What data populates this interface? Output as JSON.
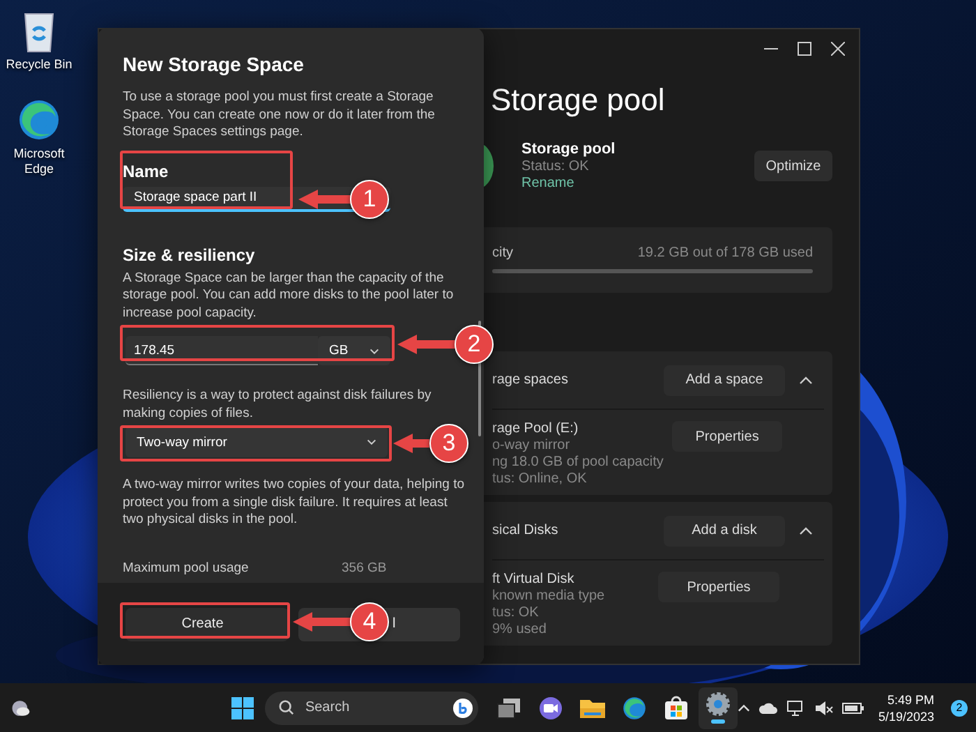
{
  "desktop_icons": [
    {
      "label": "Recycle Bin",
      "kind": "recycle"
    },
    {
      "label": "Microsoft Edge",
      "kind": "edge"
    }
  ],
  "background_window": {
    "title": "Storage pool",
    "pool": {
      "name": "Storage pool",
      "status": "Status: OK",
      "link": "Rename",
      "button": "Optimize"
    },
    "capacity": {
      "label": "city",
      "usage": "19.2 GB out of 178 GB used"
    },
    "sections": [
      {
        "title": "rage spaces",
        "button": "Add a space",
        "expanded": true,
        "items": [
          {
            "lines": [
              "rage Pool (E:)",
              "o-way mirror",
              "ng 18.0 GB of pool capacity",
              "tus: Online, OK"
            ],
            "button": "Properties"
          }
        ]
      },
      {
        "title": "sical Disks",
        "button": "Add a disk",
        "expanded": true,
        "items": [
          {
            "lines": [
              "ft Virtual Disk",
              "known media type",
              "tus: OK",
              "9% used"
            ],
            "button": "Properties"
          }
        ]
      }
    ]
  },
  "dialog": {
    "title": "New Storage Space",
    "intro": "To use a storage pool you must first create a Storage Space. You can create one now or do it later from the Storage Spaces settings page.",
    "name_label": "Name",
    "name_value": "Storage space part II",
    "size_heading": "Size & resiliency",
    "size_text": "A Storage Space can be larger than the capacity of the storage pool. You can add more disks to the pool later to increase pool capacity.",
    "size_value": "178.45",
    "size_unit": "GB",
    "resiliency_text": "Resiliency is a way to protect against disk failures by making copies of files.",
    "resiliency_value": "Two-way mirror",
    "resiliency_note": "A two-way mirror writes two copies of your data, helping to protect you from a single disk failure. It requires at least two physical disks in the pool.",
    "usage_label": "Maximum pool usage",
    "usage_value": "356 GB",
    "buttons": [
      {
        "label": "Create",
        "kind": "primary"
      },
      {
        "label": "l",
        "kind": "secondary"
      }
    ]
  },
  "annotations": [
    {
      "number": "1"
    },
    {
      "number": "2"
    },
    {
      "number": "3"
    },
    {
      "number": "4"
    }
  ],
  "taskbar": {
    "search": "Search",
    "apps": [
      {
        "kind": "taskview",
        "active": false
      },
      {
        "kind": "chat",
        "active": false
      },
      {
        "kind": "folder",
        "active": false
      },
      {
        "kind": "edge",
        "active": false
      },
      {
        "kind": "store",
        "active": false
      },
      {
        "kind": "settings",
        "active": true
      }
    ],
    "time": "5:49 PM",
    "date": "5/19/2023",
    "notifications": "2"
  }
}
